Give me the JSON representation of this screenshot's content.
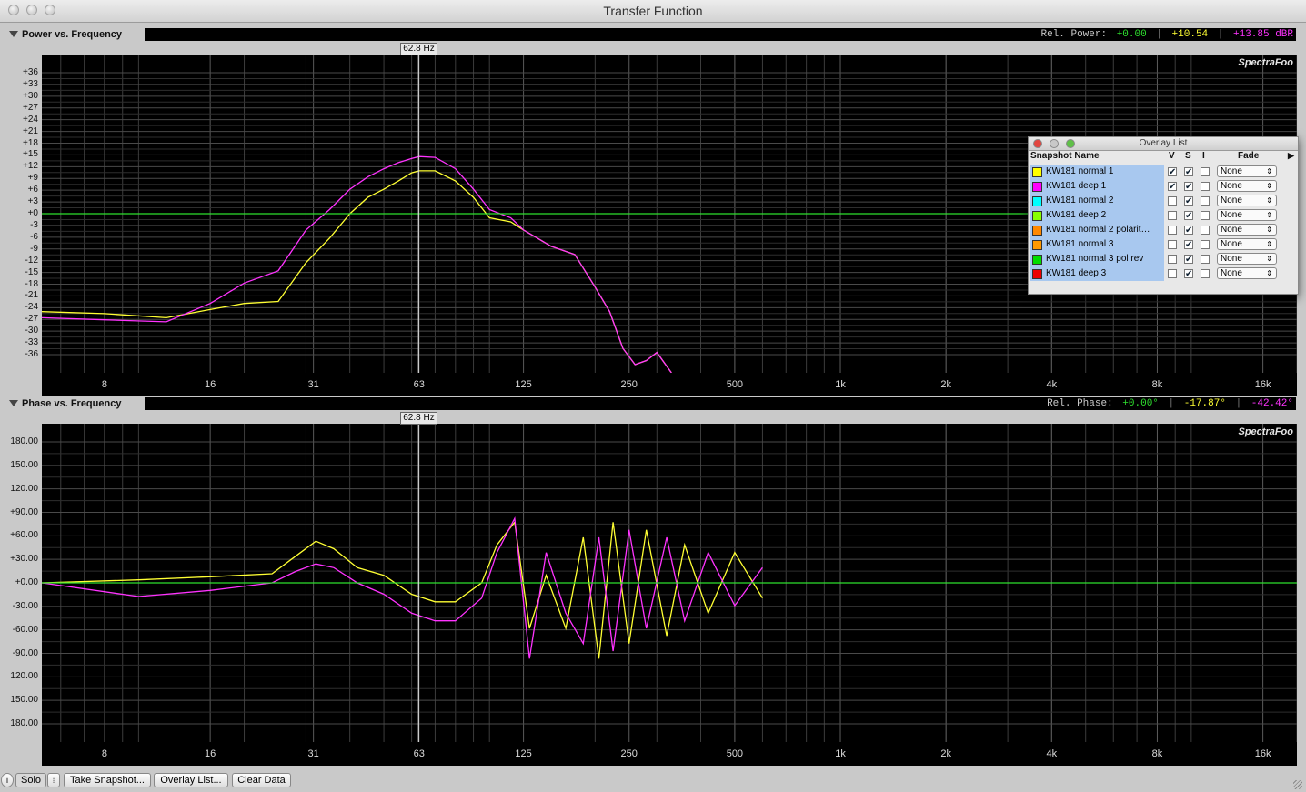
{
  "window": {
    "title": "Transfer Function"
  },
  "power_panel": {
    "title": "Power vs. Frequency",
    "readout_label": "Rel. Power:",
    "readout_values": [
      "+0.00",
      "+10.54",
      "+13.85 dBR"
    ],
    "readout_colors": [
      "#2ee02e",
      "#ffff33",
      "#ff33ff"
    ],
    "cursor_label": "62.8 Hz",
    "brand": "SpectraFoo",
    "y_ticks": [
      "+36",
      "+33",
      "+30",
      "+27",
      "+24",
      "+21",
      "+18",
      "+15",
      "+12",
      "+9",
      "+6",
      "+3",
      "+0",
      "-3",
      "-6",
      "-9",
      "-12",
      "-15",
      "-18",
      "-21",
      "-24",
      "-27",
      "-30",
      "-33",
      "-36"
    ],
    "x_ticks": [
      "8",
      "16",
      "31",
      "63",
      "125",
      "250",
      "500",
      "1k",
      "2k",
      "4k",
      "8k",
      "16k"
    ]
  },
  "phase_panel": {
    "title": "Phase vs. Frequency",
    "readout_label": "Rel. Phase:",
    "readout_values": [
      "+0.00°",
      "-17.87°",
      "-42.42°"
    ],
    "readout_colors": [
      "#2ee02e",
      "#ffff33",
      "#ff33ff"
    ],
    "cursor_label": "62.8 Hz",
    "brand": "SpectraFoo",
    "y_ticks": [
      "180.00",
      "150.00",
      "120.00",
      "+90.00",
      "+60.00",
      "+30.00",
      "+0.00",
      "-30.00",
      "-60.00",
      "-90.00",
      "120.00",
      "150.00",
      "180.00"
    ],
    "x_ticks": [
      "8",
      "16",
      "31",
      "63",
      "125",
      "250",
      "500",
      "1k",
      "2k",
      "4k",
      "8k",
      "16k"
    ]
  },
  "overlay_list": {
    "title": "Overlay List",
    "headers": {
      "name": "Snapshot Name",
      "v": "V",
      "s": "S",
      "i": "I",
      "fade": "Fade"
    },
    "rows": [
      {
        "name": "KW181 normal 1",
        "color": "#ffff00",
        "v": true,
        "s": true,
        "i": false,
        "fade": "None"
      },
      {
        "name": "KW181 deep 1",
        "color": "#ff00ff",
        "v": true,
        "s": true,
        "i": false,
        "fade": "None"
      },
      {
        "name": "KW181 normal 2",
        "color": "#00ffff",
        "v": false,
        "s": true,
        "i": false,
        "fade": "None"
      },
      {
        "name": "KW181 deep 2",
        "color": "#88ff00",
        "v": false,
        "s": true,
        "i": false,
        "fade": "None"
      },
      {
        "name": "KW181 normal 2 polarit…",
        "color": "#ff8800",
        "v": false,
        "s": true,
        "i": false,
        "fade": "None"
      },
      {
        "name": "KW181 normal 3",
        "color": "#ff9900",
        "v": false,
        "s": true,
        "i": false,
        "fade": "None"
      },
      {
        "name": "KW181 normal 3 pol rev",
        "color": "#00dd00",
        "v": false,
        "s": true,
        "i": false,
        "fade": "None"
      },
      {
        "name": "KW181 deep 3",
        "color": "#ee0000",
        "v": false,
        "s": true,
        "i": false,
        "fade": "None"
      }
    ]
  },
  "toolbar": {
    "solo_label": "Solo",
    "take_snapshot_label": "Take Snapshot...",
    "overlay_list_label": "Overlay List...",
    "clear_data_label": "Clear Data"
  },
  "chart_data": [
    {
      "type": "line",
      "title": "Power vs. Frequency",
      "xlabel": "",
      "ylabel": "",
      "x_scale": "log",
      "xlim": [
        5.3,
        20000
      ],
      "ylim": [
        -39,
        39
      ],
      "grid": true,
      "series": [
        {
          "name": "KW181 normal 1",
          "color": "#ffff33",
          "x": [
            5.3,
            8,
            12,
            16,
            20,
            25,
            30,
            35,
            40,
            45,
            50,
            55,
            60,
            63,
            70,
            80,
            90,
            100,
            115,
            125,
            150,
            175,
            200,
            220,
            240,
            260,
            280,
            300,
            330
          ],
          "y": [
            -24,
            -24.5,
            -25.5,
            -23.5,
            -22,
            -21.5,
            -12,
            -6,
            0,
            4,
            6,
            8,
            10,
            10.5,
            10.5,
            8,
            4,
            -1,
            -2,
            -4,
            -8,
            -10,
            -18,
            -24,
            -33,
            -37,
            -36,
            -34,
            -39
          ]
        },
        {
          "name": "KW181 deep 1",
          "color": "#ff33ff",
          "x": [
            5.3,
            8,
            12,
            16,
            20,
            25,
            30,
            35,
            40,
            45,
            50,
            55,
            60,
            63,
            70,
            80,
            90,
            100,
            115,
            125,
            150,
            175,
            200,
            220,
            240,
            260,
            280,
            300,
            330
          ],
          "y": [
            -25.5,
            -26,
            -26.5,
            -22,
            -17,
            -14,
            -4,
            1,
            6,
            9,
            11,
            12.5,
            13.5,
            14,
            13.8,
            11,
            6,
            1,
            -1,
            -4,
            -8,
            -10,
            -18,
            -24,
            -33,
            -37,
            -36,
            -34,
            -39
          ]
        },
        {
          "name": "",
          "color": "#2ee02e",
          "x": [
            5.3,
            20000
          ],
          "y": [
            0,
            0
          ]
        }
      ]
    },
    {
      "type": "line",
      "title": "Phase vs. Frequency",
      "xlabel": "",
      "ylabel": "",
      "x_scale": "log",
      "xlim": [
        5.3,
        20000
      ],
      "ylim": [
        -210,
        210
      ],
      "grid": true,
      "series": [
        {
          "name": "KW181 normal 1",
          "color": "#ffff33",
          "x": [
            5.3,
            10,
            16,
            24,
            28,
            32,
            36,
            42,
            50,
            60,
            70,
            80,
            95,
            105,
            118,
            130,
            145,
            165,
            185,
            205,
            225,
            250,
            280,
            320,
            360,
            420,
            500,
            600
          ],
          "y": [
            0,
            4,
            8,
            12,
            35,
            55,
            45,
            20,
            10,
            -15,
            -25,
            -25,
            0,
            50,
            80,
            -60,
            10,
            -60,
            60,
            -100,
            80,
            -80,
            70,
            -70,
            50,
            -40,
            40,
            -20
          ]
        },
        {
          "name": "KW181 deep 1",
          "color": "#ff33ff",
          "x": [
            5.3,
            10,
            16,
            24,
            28,
            32,
            36,
            42,
            50,
            60,
            70,
            80,
            95,
            105,
            118,
            130,
            145,
            165,
            185,
            205,
            225,
            250,
            280,
            320,
            360,
            420,
            500,
            600
          ],
          "y": [
            0,
            -18,
            -10,
            0,
            15,
            25,
            20,
            0,
            -15,
            -40,
            -50,
            -50,
            -20,
            40,
            85,
            -100,
            40,
            -40,
            -80,
            60,
            -90,
            70,
            -60,
            60,
            -50,
            40,
            -30,
            20
          ]
        },
        {
          "name": "",
          "color": "#2ee02e",
          "x": [
            5.3,
            20000
          ],
          "y": [
            0,
            0
          ]
        }
      ]
    }
  ]
}
